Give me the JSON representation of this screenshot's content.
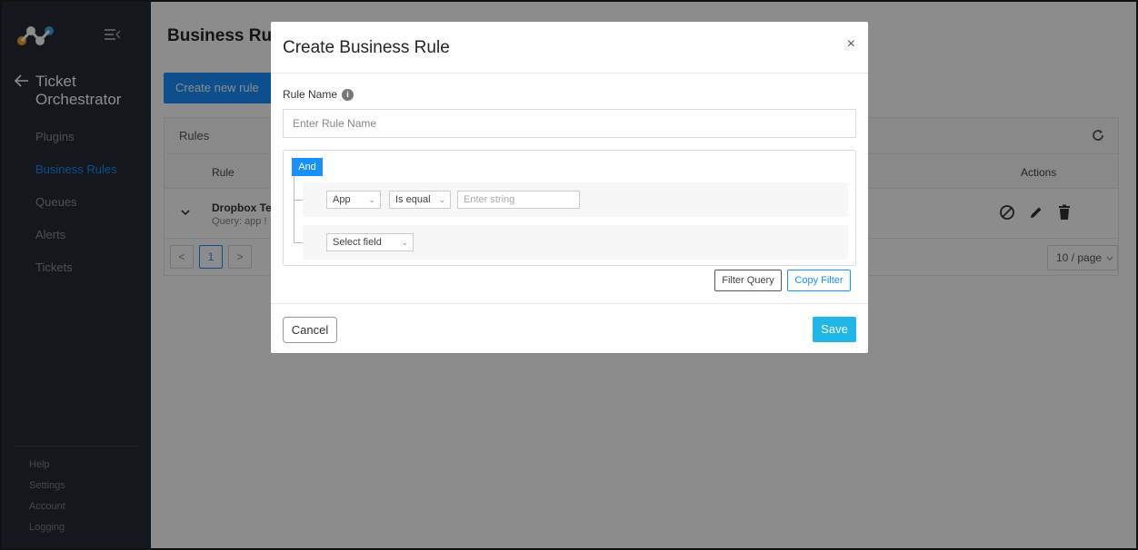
{
  "sidebar": {
    "app_title": "Ticket Orchestrator",
    "nav": [
      {
        "label": "Plugins",
        "active": false
      },
      {
        "label": "Business Rules",
        "active": true
      },
      {
        "label": "Queues",
        "active": false
      },
      {
        "label": "Alerts",
        "active": false
      },
      {
        "label": "Tickets",
        "active": false
      }
    ],
    "footer": [
      {
        "label": "Help"
      },
      {
        "label": "Settings"
      },
      {
        "label": "Account"
      },
      {
        "label": "Logging"
      }
    ]
  },
  "page": {
    "title": "Business Rules",
    "create_button": "Create new rule",
    "card_title": "Rules",
    "columns": {
      "rule": "Rule",
      "actions": "Actions"
    },
    "rows": [
      {
        "name": "Dropbox Te",
        "query": "Query: app !"
      }
    ],
    "pagination": {
      "prev": "<",
      "current": "1",
      "next": ">"
    },
    "page_size": "10 / page"
  },
  "modal": {
    "title": "Create Business Rule",
    "close": "×",
    "rule_name_label": "Rule Name",
    "rule_name_placeholder": "Enter Rule Name",
    "combinator": "And",
    "rules": [
      {
        "field": "App",
        "operator": "Is equal",
        "value_placeholder": "Enter string"
      }
    ],
    "new_rule_field": "Select field",
    "filter_query_button": "Filter Query",
    "copy_filter_button": "Copy Filter",
    "cancel_button": "Cancel",
    "save_button": "Save"
  },
  "colors": {
    "primary": "#1890ff",
    "save": "#21b6e8",
    "sidebar_bg": "#252b33"
  }
}
